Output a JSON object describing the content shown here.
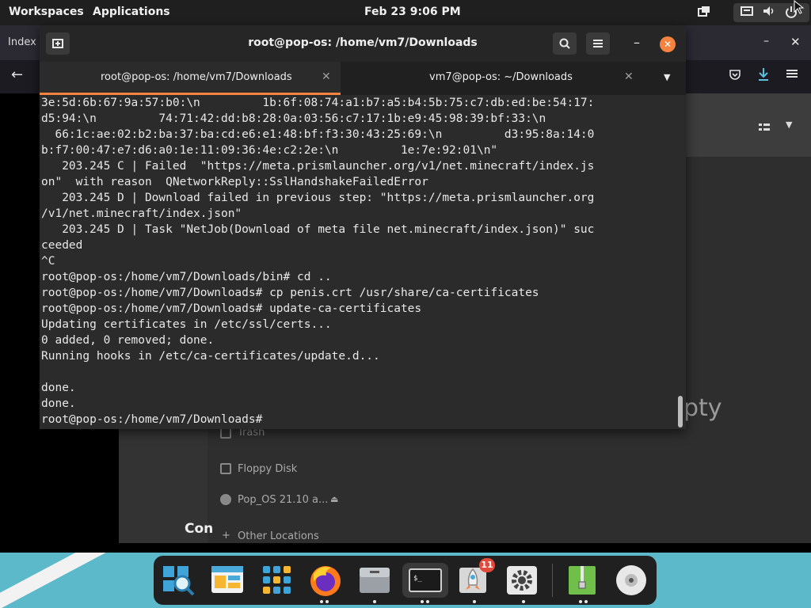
{
  "topbar": {
    "workspaces": "Workspaces",
    "applications": "Applications",
    "clock": "Feb 23   9:06 PM"
  },
  "browser": {
    "tab_text": "Index c"
  },
  "files": {
    "empty_text": "pty",
    "con_text": "Con",
    "sidebar": [
      {
        "label": "Trash"
      },
      {
        "label": "Floppy Disk"
      },
      {
        "label": "Pop_OS 21.10 a..."
      },
      {
        "label": "Other Locations"
      }
    ]
  },
  "terminal": {
    "title": "root@pop-os: /home/vm7/Downloads",
    "tabs": [
      {
        "label": "root@pop-os: /home/vm7/Downloads"
      },
      {
        "label": "vm7@pop-os: ~/Downloads"
      }
    ],
    "output": "3e:5d:6b:67:9a:57:b0:\\n         1b:6f:08:74:a1:b7:a5:b4:5b:75:c7:db:ed:be:54:17:\nd5:94:\\n         74:71:42:dd:b8:28:0a:03:56:c7:17:1b:e9:45:98:39:bf:33:\\n\n  66:1c:ae:02:b2:ba:37:ba:cd:e6:e1:48:bf:f3:30:43:25:69:\\n         d3:95:8a:14:0\nb:f7:00:47:e7:d6:a0:1e:11:09:36:4e:c2:2e:\\n         1e:7e:92:01\\n\"\n   203.245 C | Failed  \"https://meta.prismlauncher.org/v1/net.minecraft/index.js\non\"  with reason  QNetworkReply::SslHandshakeFailedError\n   203.245 D | Download failed in previous step: \"https://meta.prismlauncher.org\n/v1/net.minecraft/index.json\"\n   203.245 D | Task \"NetJob(Download of meta file net.minecraft/index.json)\" suc\nceeded\n^C\nroot@pop-os:/home/vm7/Downloads/bin# cd ..\nroot@pop-os:/home/vm7/Downloads# cp penis.crt /usr/share/ca-certificates\nroot@pop-os:/home/vm7/Downloads# update-ca-certificates\nUpdating certificates in /etc/ssl/certs...\n0 added, 0 removed; done.\nRunning hooks in /etc/ca-certificates/update.d...\n\ndone.\ndone.\nroot@pop-os:/home/vm7/Downloads# "
  },
  "dock": {
    "badge_count": "11",
    "apps": [
      {
        "name": "search-app-icon"
      },
      {
        "name": "files-preview-icon"
      },
      {
        "name": "app-grid-icon"
      },
      {
        "name": "firefox-icon"
      },
      {
        "name": "file-manager-icon"
      },
      {
        "name": "terminal-icon"
      },
      {
        "name": "pop-shop-icon"
      },
      {
        "name": "settings-gear-icon"
      },
      {
        "name": "archive-manager-icon"
      },
      {
        "name": "disc-icon"
      }
    ]
  },
  "colors": {
    "accent": "#f5833f",
    "dock_background": "#5bb9c9",
    "badge": "#e24b3b"
  }
}
